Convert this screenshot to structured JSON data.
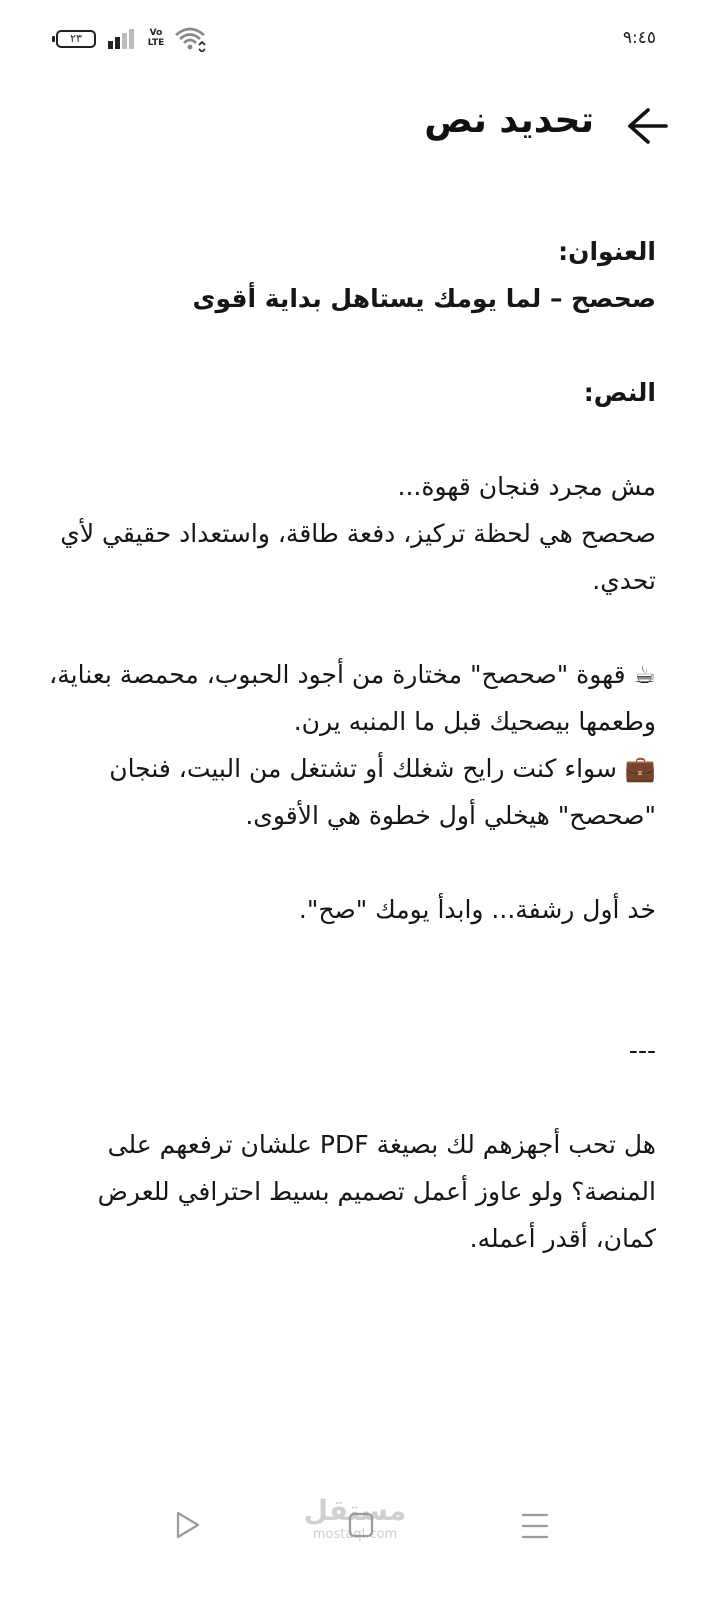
{
  "status_bar": {
    "battery_level": "٢٣",
    "network_label": "Vo\nLTE",
    "time": "٩:٤٥"
  },
  "header": {
    "title": "تحديد نص",
    "back_icon": "arrow-right-icon"
  },
  "content": {
    "title_label": "العنوان:",
    "title_value": "صحصح – لما يومك يستاهل بداية أقوى",
    "text_label": "النص:",
    "intro_line1": "مش مجرد فنجان قهوة...",
    "intro_line2": "صحصح هي لحظة تركيز، دفعة طاقة، واستعداد حقيقي لأي تحدي.",
    "feature1": "☕ قهوة \"صحصح\" مختارة من أجود الحبوب، محمصة بعناية، وطعمها بيصحيك قبل ما المنبه يرن.",
    "feature2": "💼 سواء كنت رايح شغلك أو تشتغل من البيت، فنجان \"صحصح\" هيخلي أول خطوة هي الأقوى.",
    "closing": "خد أول رشفة... وابدأ يومك \"صح\".",
    "separator": "---",
    "question": "هل تحب أجهزهم لك بصيغة PDF علشان ترفعهم على المنصة؟ ولو عاوز أعمل تصميم بسيط احترافي للعرض كمان، أقدر أعمله."
  },
  "nav_bar": {
    "icons": [
      "play-triangle-icon",
      "square-home-icon",
      "menu-lines-icon"
    ]
  },
  "watermark": {
    "arabic": "مستقل",
    "latin": "mostaql.com"
  }
}
